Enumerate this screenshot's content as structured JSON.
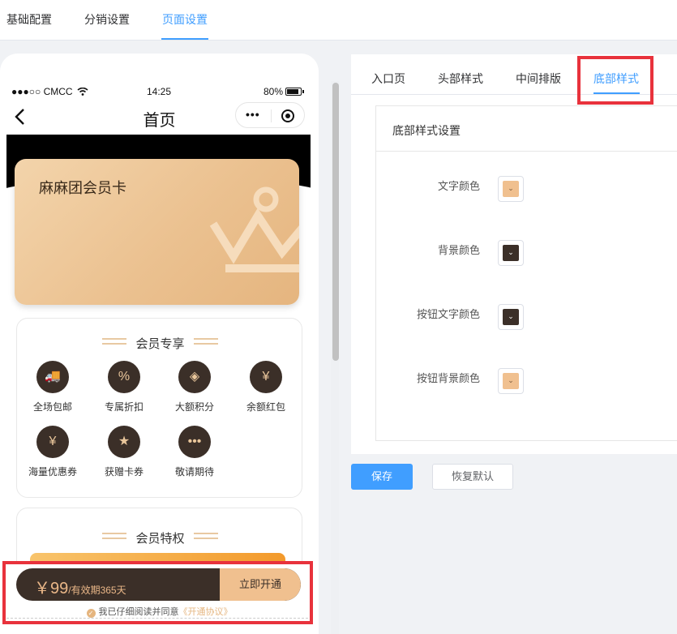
{
  "top_tabs": [
    "基础配置",
    "分销设置",
    "页面设置"
  ],
  "status_bar": {
    "carrier": "●●●○○ CMCC",
    "time": "14:25",
    "battery": "80%"
  },
  "nav": {
    "title": "首页",
    "capsule_dots": "•••"
  },
  "card": {
    "title": "麻麻团会员卡"
  },
  "section1": {
    "title": "会员专享",
    "benefits": [
      {
        "label": "全场包邮",
        "glyph": "🚚"
      },
      {
        "label": "专属折扣",
        "glyph": "%"
      },
      {
        "label": "大额积分",
        "glyph": "◈"
      },
      {
        "label": "余额红包",
        "glyph": "¥"
      },
      {
        "label": "海量优惠券",
        "glyph": "¥"
      },
      {
        "label": "获赠卡券",
        "glyph": "★"
      },
      {
        "label": "敬请期待",
        "glyph": "•••"
      }
    ]
  },
  "section2": {
    "title": "会员特权"
  },
  "pay_bar": {
    "price": "￥99",
    "validity": "/有效期365天",
    "button": "立即开通"
  },
  "agreement": {
    "text": "我已仔细阅读并同意",
    "link": "《开通协议》",
    "check": "✓"
  },
  "right_panel": {
    "tabs": [
      "入口页",
      "头部样式",
      "中间排版",
      "底部样式"
    ],
    "header": "底部样式设置",
    "rows": [
      {
        "label": "文字颜色",
        "color": "#f0c08f"
      },
      {
        "label": "背景颜色",
        "color": "#3b2f28"
      },
      {
        "label": "按钮文字颜色",
        "color": "#3b2f28"
      },
      {
        "label": "按钮背景颜色",
        "color": "#f0c08f"
      }
    ],
    "save": "保存",
    "reset": "恢复默认"
  },
  "colors": {
    "accent": "#409eff",
    "highlight": "#e8323c",
    "gold": "#e5b57f",
    "dark": "#3b2f28"
  }
}
